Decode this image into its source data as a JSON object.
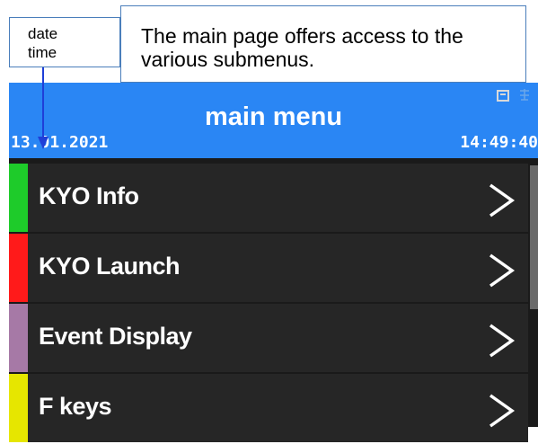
{
  "callouts": {
    "date_time": {
      "line1": "date",
      "line2": "time"
    },
    "description": {
      "line1": "The main page offers access to the",
      "line2": "various submenus."
    }
  },
  "header": {
    "title": "main menu",
    "date": "13.01.2021",
    "time": "14:49:40",
    "background_color": "#2a86f4",
    "status_icons": [
      "display-icon",
      "network-icon"
    ]
  },
  "menu": {
    "items": [
      {
        "label": "KYO Info",
        "stripe_color": "#1ecb2a",
        "icon": "chevron-right-icon"
      },
      {
        "label": "KYO Launch",
        "stripe_color": "#ff1a1a",
        "icon": "chevron-right-icon"
      },
      {
        "label": "Event Display",
        "stripe_color": "#a679a6",
        "icon": "chevron-right-icon"
      },
      {
        "label": "F keys",
        "stripe_color": "#e6e600",
        "icon": "chevron-right-icon"
      }
    ]
  }
}
